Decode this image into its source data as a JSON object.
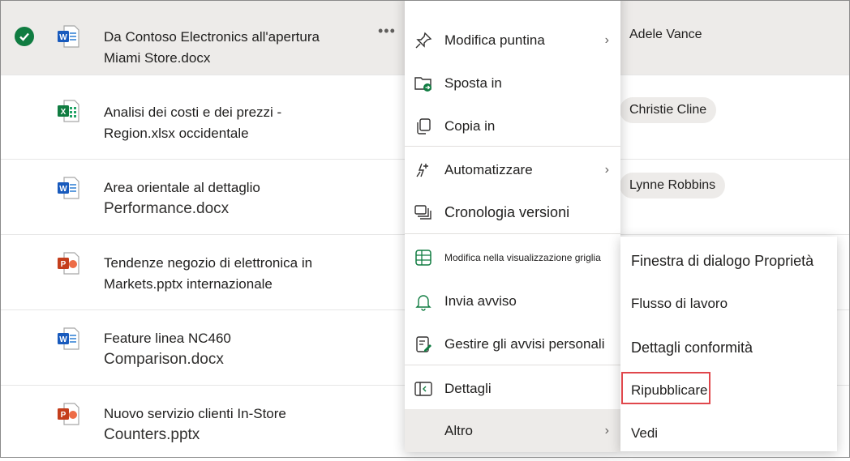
{
  "files": [
    {
      "name_line1": "Da Contoso Electronics all'apertura",
      "name_line2": "Miami Store.docx",
      "type": "word",
      "person": "Adele Vance",
      "selected": true
    },
    {
      "name_line1": "Analisi dei costi e dei prezzi -",
      "name_line2": "Region.xlsx occidentale",
      "type": "excel",
      "person": "Christie Cline"
    },
    {
      "name_line1": "Area orientale al dettaglio",
      "name_line2": "Performance.docx",
      "type": "word",
      "person": "Lynne Robbins"
    },
    {
      "name_line1": "Tendenze negozio di elettronica in",
      "name_line2": "Markets.pptx internazionale",
      "type": "powerpoint",
      "person": ""
    },
    {
      "name_line1": "Feature linea NC460",
      "name_line2": "Comparison.docx",
      "type": "word",
      "person": ""
    },
    {
      "name_line1": "Nuovo servizio clienti In-Store",
      "name_line2": "Counters.pptx",
      "type": "powerpoint",
      "person": ""
    }
  ],
  "more_glyph": "•••",
  "chevron_glyph": "›",
  "menu": {
    "items": [
      {
        "label": "Modifica puntina",
        "icon": "pin-icon",
        "has_submenu": true
      },
      {
        "label": "Sposta in",
        "icon": "move-folder-icon"
      },
      {
        "label": "Copia in",
        "icon": "copy-icon"
      },
      {
        "label": "Automatizzare",
        "icon": "automate-icon",
        "has_submenu": true
      },
      {
        "label": "Cronologia versioni",
        "icon": "version-history-icon"
      },
      {
        "label": "Modifica nella visualizzazione griglia",
        "icon": "grid-icon"
      },
      {
        "label": "Invia avviso",
        "icon": "bell-icon"
      },
      {
        "label": "Gestire gli avvisi personali",
        "icon": "manage-alerts-icon"
      },
      {
        "label": "Dettagli",
        "icon": "details-icon"
      },
      {
        "label": "Altro",
        "has_submenu": true
      }
    ]
  },
  "submenu": {
    "items": [
      {
        "label": "Finestra di dialogo Proprietà"
      },
      {
        "label": "Flusso di lavoro"
      },
      {
        "label": "Dettagli conformità"
      },
      {
        "label": "Ripubblicare",
        "highlighted": true
      },
      {
        "label": "Vedi"
      }
    ]
  },
  "colors": {
    "accent": "#107c41",
    "highlight": "#e0474c",
    "word": "#185abd",
    "excel": "#107c41",
    "powerpoint": "#c43e1c"
  }
}
